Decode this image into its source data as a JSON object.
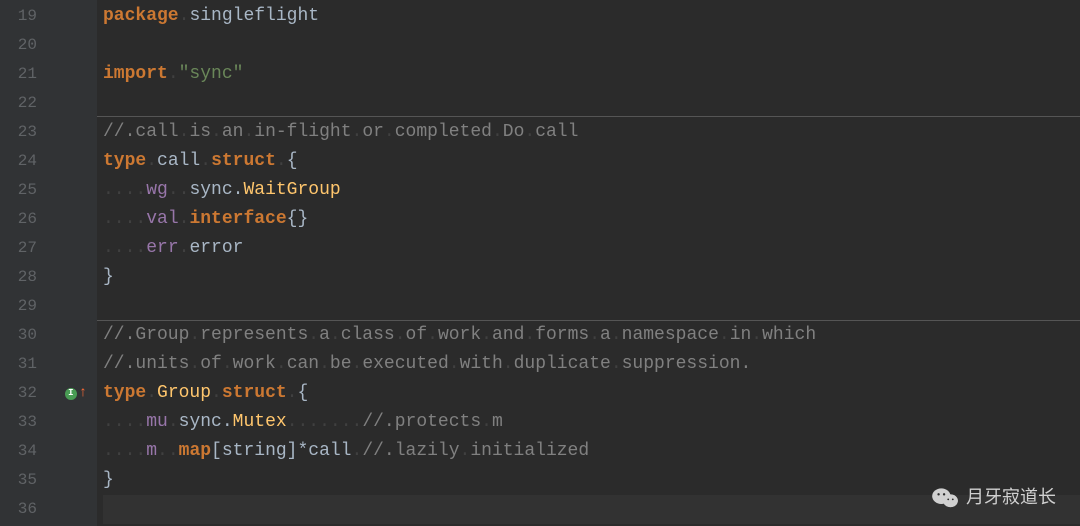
{
  "line_numbers": [
    "19",
    "20",
    "21",
    "22",
    "23",
    "24",
    "25",
    "26",
    "27",
    "28",
    "29",
    "30",
    "31",
    "32",
    "33",
    "34",
    "35",
    "36"
  ],
  "code": {
    "l19": {
      "kw1": "package",
      "ws1": ".",
      "id1": "singleflight"
    },
    "l21": {
      "kw1": "import",
      "ws1": ".",
      "str1": "\"sync\""
    },
    "l23": {
      "ws0": "//.",
      "c1": "call",
      "ws1": ".",
      "c2": "is",
      "ws2": ".",
      "c3": "an",
      "ws3": ".",
      "c4": "in-flight",
      "ws4": ".",
      "c5": "or",
      "ws5": ".",
      "c6": "completed",
      "ws6": ".",
      "c7": "Do",
      "ws7": ".",
      "c8": "call"
    },
    "l24": {
      "kw1": "type",
      "ws1": ".",
      "id1": "call",
      "ws2": ".",
      "kw2": "struct",
      "ws3": ".",
      "br1": "{"
    },
    "l25": {
      "indent": "....",
      "fld": "wg",
      "ws1": "..",
      "id1": "sync",
      "dot": ".",
      "tn": "WaitGroup"
    },
    "l26": {
      "indent": "....",
      "fld": "val",
      "ws1": ".",
      "kw1": "interface",
      "br1": "{}"
    },
    "l27": {
      "indent": "....",
      "fld": "err",
      "ws1": ".",
      "id1": "error"
    },
    "l28": {
      "br1": "}"
    },
    "l30": {
      "ws0": "//.",
      "c1": "Group",
      "ws1": ".",
      "c2": "represents",
      "ws2": ".",
      "c3": "a",
      "ws3": ".",
      "c4": "class",
      "ws4": ".",
      "c5": "of",
      "ws5": ".",
      "c6": "work",
      "ws6": ".",
      "c7": "and",
      "ws7": ".",
      "c8": "forms",
      "ws8": ".",
      "c9": "a",
      "ws9": ".",
      "c10": "namespace",
      "ws10": ".",
      "c11": "in",
      "ws11": ".",
      "c12": "which"
    },
    "l31": {
      "ws0": "//.",
      "c1": "units",
      "ws1": ".",
      "c2": "of",
      "ws2": ".",
      "c3": "work",
      "ws3": ".",
      "c4": "can",
      "ws4": ".",
      "c5": "be",
      "ws5": ".",
      "c6": "executed",
      "ws6": ".",
      "c7": "with",
      "ws7": ".",
      "c8": "duplicate",
      "ws8": ".",
      "c9": "suppression."
    },
    "l32": {
      "kw1": "type",
      "ws1": ".",
      "tn": "Group",
      "ws2": ".",
      "kw2": "struct",
      "ws3": ".",
      "br1": "{"
    },
    "l33": {
      "indent": "....",
      "fld": "mu",
      "ws1": ".",
      "id1": "sync",
      "dot": ".",
      "tn": "Mutex",
      "ws2": ".......",
      "c0": "//.",
      "c1": "protects",
      "ws3": ".",
      "c2": "m"
    },
    "l34": {
      "indent": "....",
      "fld": "m",
      "ws1": "..",
      "kw1": "map",
      "br1": "[",
      "id1": "string",
      "br2": "]*",
      "id2": "call",
      "ws2": ".",
      "c0": "//.",
      "c1": "lazily",
      "ws3": ".",
      "c2": "initialized"
    },
    "l35": {
      "br1": "}"
    }
  },
  "marker": {
    "impl_label": "I"
  },
  "watermark": {
    "text": "月牙寂道长"
  }
}
